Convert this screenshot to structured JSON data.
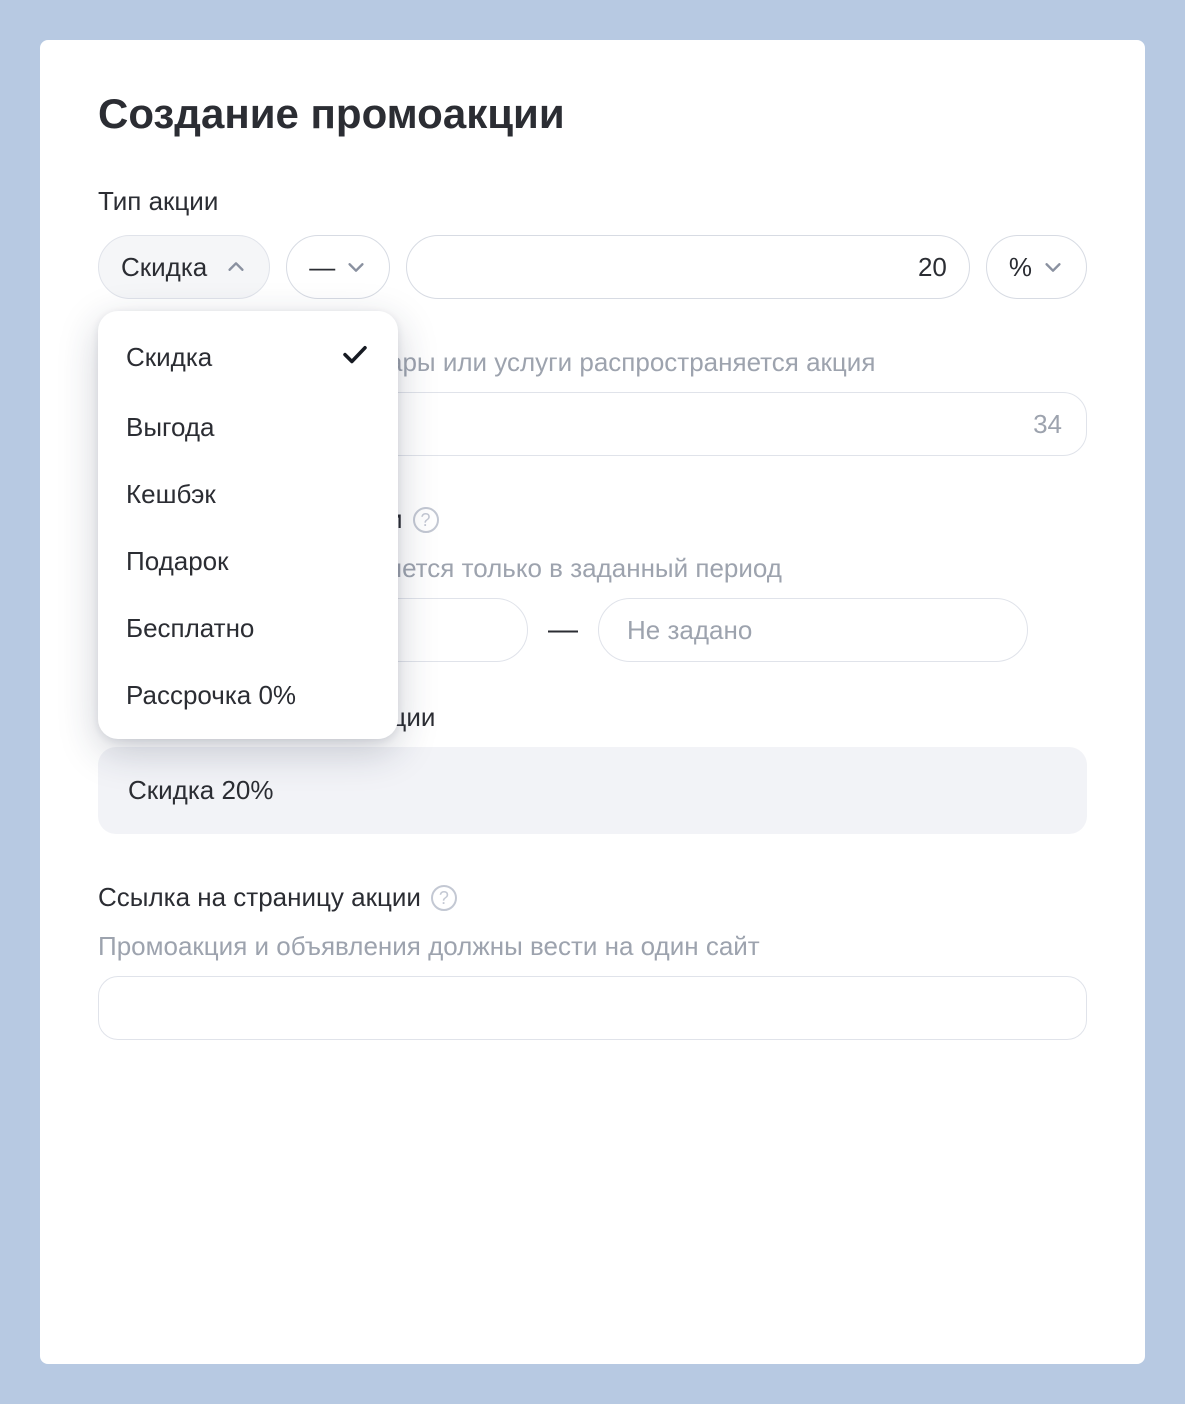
{
  "title": "Создание промоакции",
  "type_section": {
    "label": "Тип акции",
    "select_value": "Скидка",
    "dash": "—",
    "amount": "20",
    "unit": "%",
    "options": [
      {
        "label": "Скидка",
        "selected": true
      },
      {
        "label": "Выгода",
        "selected": false
      },
      {
        "label": "Кешбэк",
        "selected": false
      },
      {
        "label": "Подарок",
        "selected": false
      },
      {
        "label": "Бесплатно",
        "selected": false
      },
      {
        "label": "Рассрочка 0%",
        "selected": false
      }
    ]
  },
  "scope_section": {
    "sublabel_fragment": "ары или услуги распространяется акция",
    "counter": "34"
  },
  "period_section": {
    "label_fragment": "и",
    "sublabel_fragment": "яется только в заданный период",
    "dash": "—",
    "end_placeholder": "Не задано"
  },
  "result_section": {
    "label": "Итоговый текст промоакции",
    "value": "Скидка 20%"
  },
  "link_section": {
    "label": "Ссылка на страницу акции",
    "sublabel": "Промоакция и объявления должны вести на один сайт"
  },
  "help_glyph": "?"
}
